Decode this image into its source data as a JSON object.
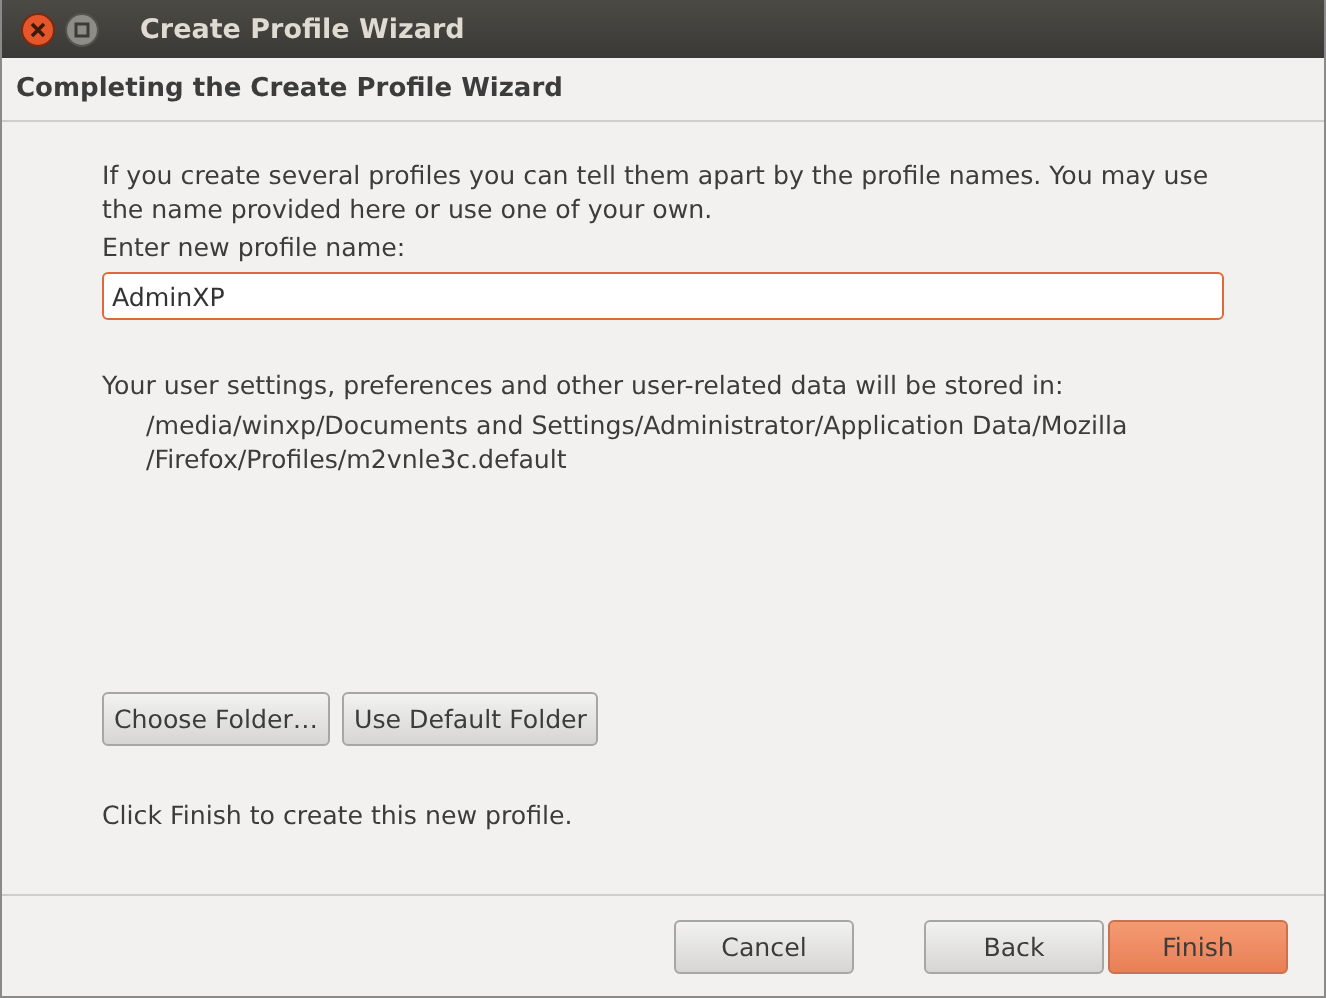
{
  "window": {
    "title": "Create Profile Wizard"
  },
  "header": {
    "title": "Completing the Create Profile Wizard"
  },
  "intro": "If you create several profiles you can tell them apart by the profile names. You may use the name provided here or use one of your own.",
  "name_field": {
    "label": "Enter new profile name:",
    "value": "AdminXP",
    "focused": true
  },
  "storage_note": "Your user settings, preferences and other user-related data will be stored in:",
  "path_lines": [
    "/media/winxp/Documents and Settings/Administrator/Application Data/Mozilla",
    "/Firefox/Profiles/m2vnle3c.default"
  ],
  "folder_buttons": [
    "Choose Folder…",
    "Use Default Folder"
  ],
  "finish_note": "Click Finish to create this new profile.",
  "buttons": [
    {
      "label": "Cancel",
      "kind": "normal"
    },
    {
      "label": "Back",
      "kind": "gap"
    },
    {
      "label": "Finish",
      "kind": "default"
    }
  ]
}
